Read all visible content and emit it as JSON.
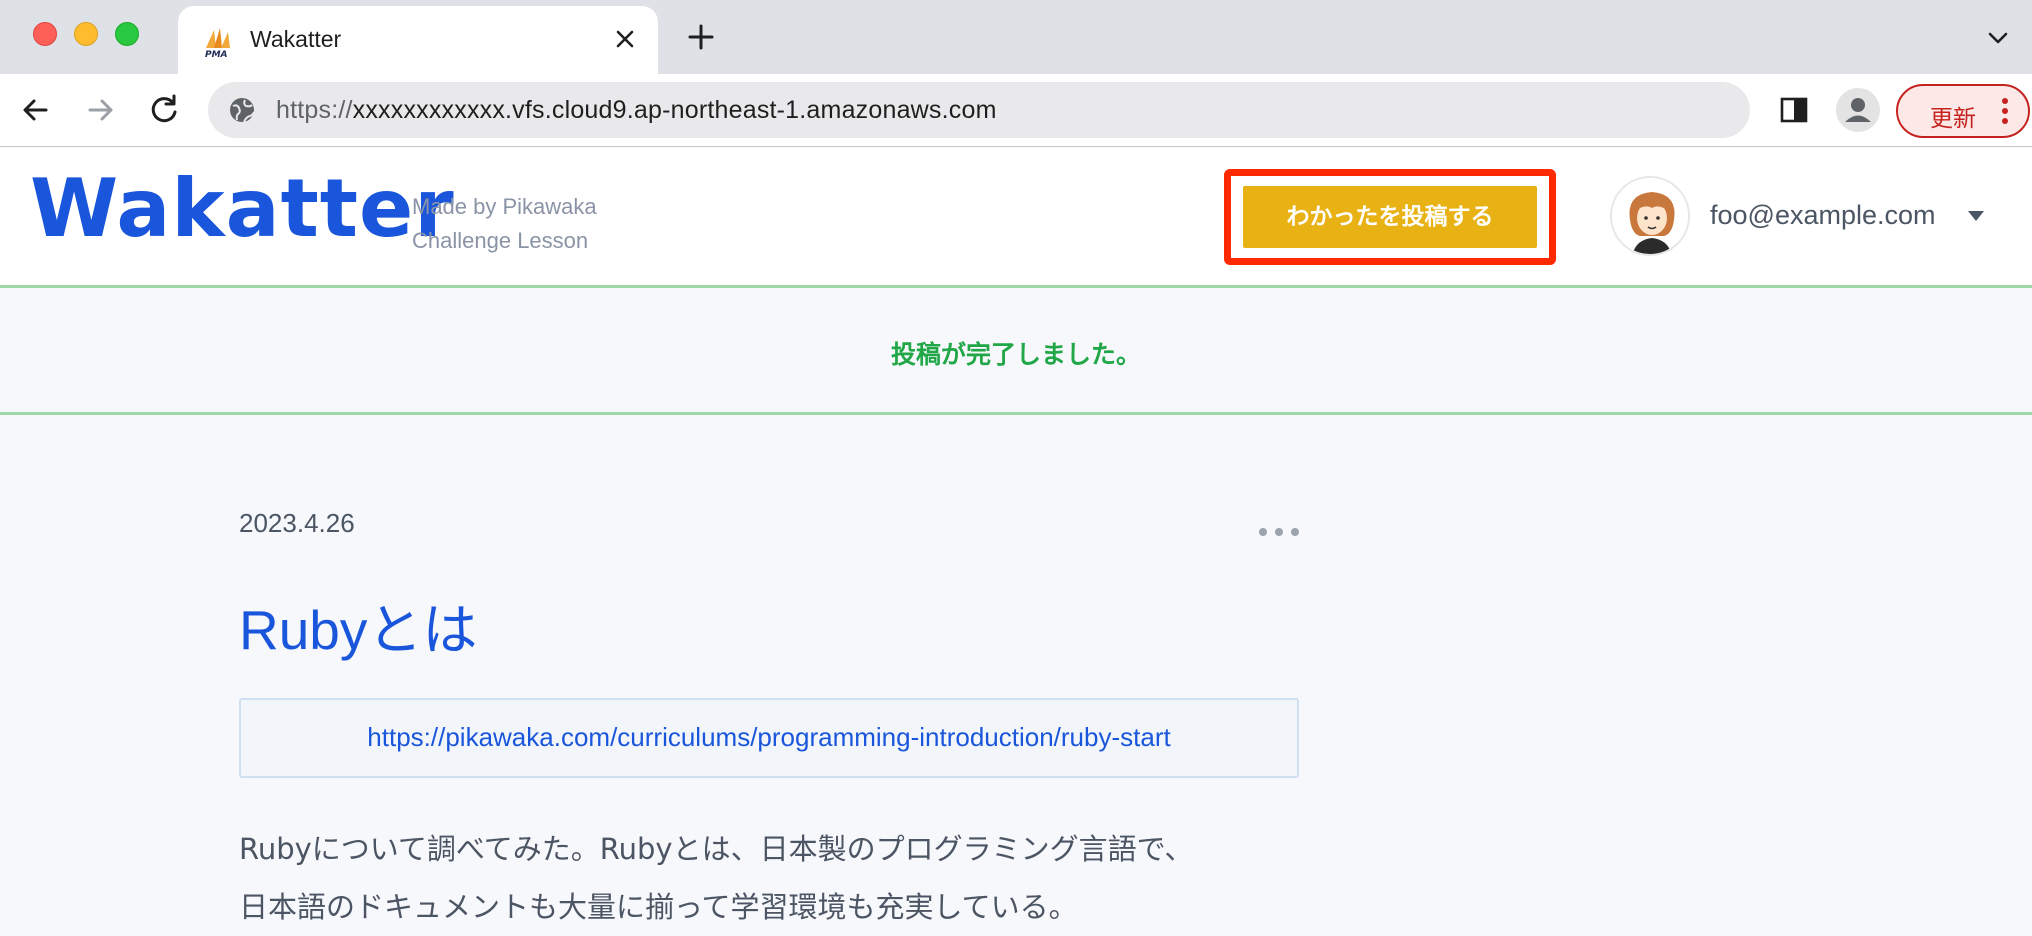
{
  "browser": {
    "tab_title": "Wakatter",
    "url_scheme": "https://",
    "url_rest": "xxxxxxxxxxxx.vfs.cloud9.ap-northeast-1.amazonaws.com",
    "update_label": "更新"
  },
  "header": {
    "logo": "Wakatter",
    "tagline_line1": "Made by Pikawaka",
    "tagline_line2": "Challenge Lesson",
    "post_button": "わかったを投稿する",
    "user_email": "foo@example.com"
  },
  "flash": {
    "message": "投稿が完了しました。"
  },
  "post": {
    "date": "2023.4.26",
    "title": "Rubyとは",
    "link": "https://pikawaka.com/curriculums/programming-introduction/ruby-start",
    "body_line1": "Rubyについて調べてみた。Rubyとは、日本製のプログラミング言語で、",
    "body_line2": "日本語のドキュメントも大量に揃って学習環境も充実している。"
  },
  "colors": {
    "brand": "#1a56db",
    "post_button": "#e8b114",
    "highlight_frame": "#ff2a00",
    "success": "#22a748"
  },
  "icons": [
    "favicon-pma",
    "close-icon",
    "plus-icon",
    "chevron-down-icon",
    "back-arrow-icon",
    "forward-arrow-icon",
    "reload-icon",
    "site-info-icon",
    "side-panel-icon",
    "profile-icon",
    "more-vert-icon",
    "caret-down-icon",
    "more-horiz-icon"
  ]
}
